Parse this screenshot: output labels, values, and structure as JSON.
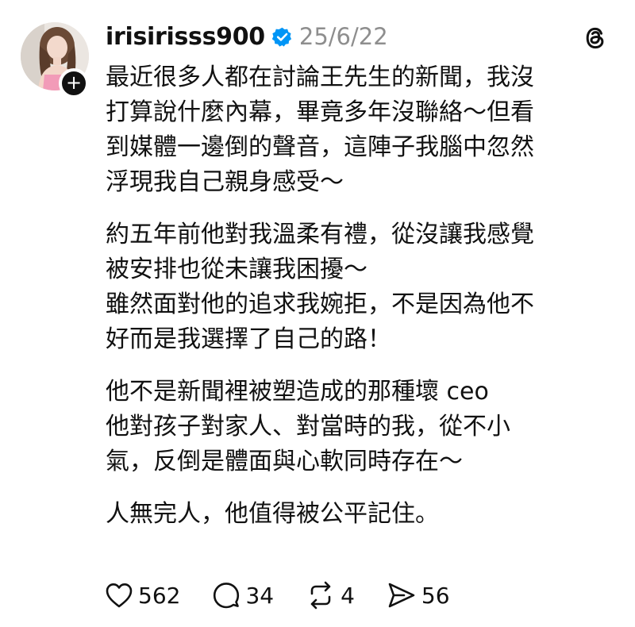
{
  "post": {
    "username": "irisirisss900",
    "date": "25/6/22",
    "paragraphs": [
      [
        "最近很多人都在討論王先生的新聞，我沒",
        "打算說什麼內幕，畢竟多年沒聯絡～但看",
        "到媒體一邊倒的聲音，這陣子我腦中忽然",
        "浮現我自己親身感受～"
      ],
      [
        "約五年前他對我溫柔有禮，從沒讓我感覺",
        "被安排也從未讓我困擾～",
        "雖然面對他的追求我婉拒，不是因為他不",
        "好而是我選擇了自己的路！"
      ],
      [
        "他不是新聞裡被塑造成的那種壞 ceo",
        "他對孩子對家人、對當時的我，從不小",
        "氣，反倒是體面與心軟同時存在～"
      ],
      [
        "人無完人，他值得被公平記住。"
      ]
    ]
  },
  "actions": {
    "likes": "562",
    "comments": "34",
    "reposts": "4",
    "shares": "56"
  },
  "icons": {
    "verified": "verified-badge-icon",
    "logo": "threads-logo-icon",
    "like": "heart-icon",
    "comment": "comment-bubble-icon",
    "repost": "repost-icon",
    "share": "send-icon",
    "follow": "plus-icon"
  },
  "colors": {
    "verified_blue": "#0095f6",
    "timestamp_gray": "#8e8e8e",
    "text": "#111111"
  }
}
